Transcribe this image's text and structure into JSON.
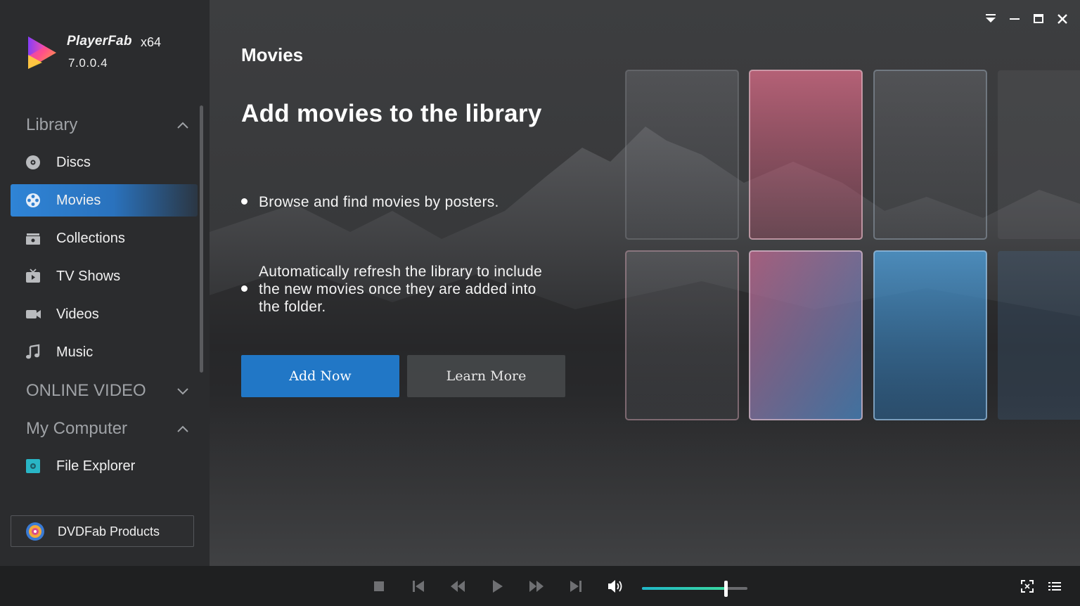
{
  "app": {
    "name": "PlayerFab",
    "arch": "x64",
    "version": "7.0.0.4"
  },
  "sidebar": {
    "library": {
      "heading": "Library",
      "items": [
        {
          "label": "Discs",
          "icon": "disc-icon"
        },
        {
          "label": "Movies",
          "icon": "film-reel-icon",
          "active": true
        },
        {
          "label": "Collections",
          "icon": "collection-box-icon"
        },
        {
          "label": "TV Shows",
          "icon": "tv-icon"
        },
        {
          "label": "Videos",
          "icon": "video-camera-icon"
        },
        {
          "label": "Music",
          "icon": "music-note-icon"
        }
      ]
    },
    "online_video": {
      "heading": "ONLINE VIDEO"
    },
    "my_computer": {
      "heading": "My Computer",
      "items": [
        {
          "label": "File Explorer",
          "icon": "file-explorer-icon"
        }
      ]
    },
    "products_button": {
      "label": "DVDFab Products",
      "icon": "dvdfab-logo-icon"
    }
  },
  "main": {
    "page_title": "Movies",
    "headline": "Add movies to the library",
    "bullets": [
      {
        "line1": "Browse and find movies by posters."
      },
      {
        "line1": "Automatically refresh the library to include",
        "line2": "the new movies once they are added into",
        "line3": "the folder."
      }
    ],
    "add_now_label": "Add Now",
    "learn_more_label": "Learn More"
  },
  "window_controls": [
    "dropdown-icon",
    "minimize-icon",
    "maximize-icon",
    "close-icon"
  ],
  "player": {
    "controls": [
      "stop-icon",
      "previous-icon",
      "rewind-icon",
      "play-icon",
      "fast-forward-icon",
      "next-icon",
      "volume-icon",
      "fullscreen-icon",
      "playlist-icon"
    ],
    "volume_fraction": 0.79
  },
  "colors": {
    "accent": "#2177c6",
    "sidebar_bg": "#2b2c2e",
    "bottom_bar_bg": "#1f2021",
    "volume_fill": "#2ac7b5"
  }
}
